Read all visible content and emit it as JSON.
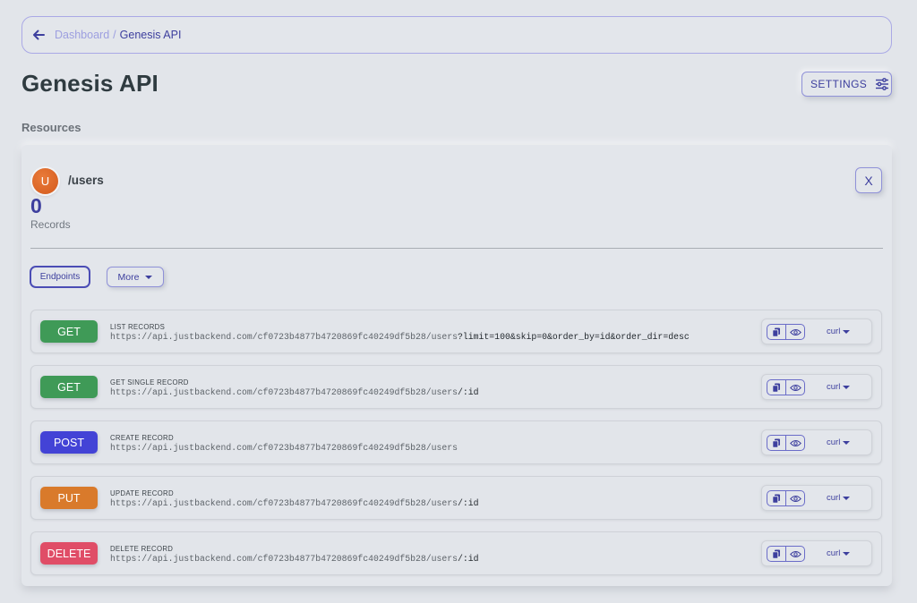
{
  "breadcrumb": {
    "parent": "Dashboard",
    "separator": "/",
    "current": "Genesis API"
  },
  "page": {
    "title": "Genesis API",
    "settings_label": "SETTINGS",
    "section_title": "Resources"
  },
  "resource": {
    "avatar_letter": "U",
    "name": "/users",
    "count": "0",
    "count_label": "Records",
    "close_label": "X",
    "tabs": {
      "endpoints": "Endpoints",
      "more": "More"
    }
  },
  "endpoints": [
    {
      "method": "GET",
      "color": "#3f9a57",
      "label": "LIST RECORDS",
      "url": "https://api.justbackend.com/cf0723b4877b4720869fc40249df5b28/users",
      "suffix": "?limit=100&skip=0&order_by=id&order_dir=desc",
      "lang": "curl"
    },
    {
      "method": "GET",
      "color": "#3f9a57",
      "label": "GET SINGLE RECORD",
      "url": "https://api.justbackend.com/cf0723b4877b4720869fc40249df5b28/users",
      "suffix": "/:id",
      "lang": "curl"
    },
    {
      "method": "POST",
      "color": "#4343d6",
      "label": "CREATE RECORD",
      "url": "https://api.justbackend.com/cf0723b4877b4720869fc40249df5b28/users",
      "suffix": "",
      "lang": "curl"
    },
    {
      "method": "PUT",
      "color": "#d97a2b",
      "label": "UPDATE RECORD",
      "url": "https://api.justbackend.com/cf0723b4877b4720869fc40249df5b28/users",
      "suffix": "/:id",
      "lang": "curl"
    },
    {
      "method": "DELETE",
      "color": "#e04d67",
      "label": "DELETE RECORD",
      "url": "https://api.justbackend.com/cf0723b4877b4720869fc40249df5b28/users",
      "suffix": "/:id",
      "lang": "curl"
    }
  ],
  "icons": {
    "back": "arrow-left-icon",
    "settings": "sliders-icon",
    "copy": "copy-icon",
    "view": "eye-icon",
    "dropdown": "caret-down-icon"
  }
}
